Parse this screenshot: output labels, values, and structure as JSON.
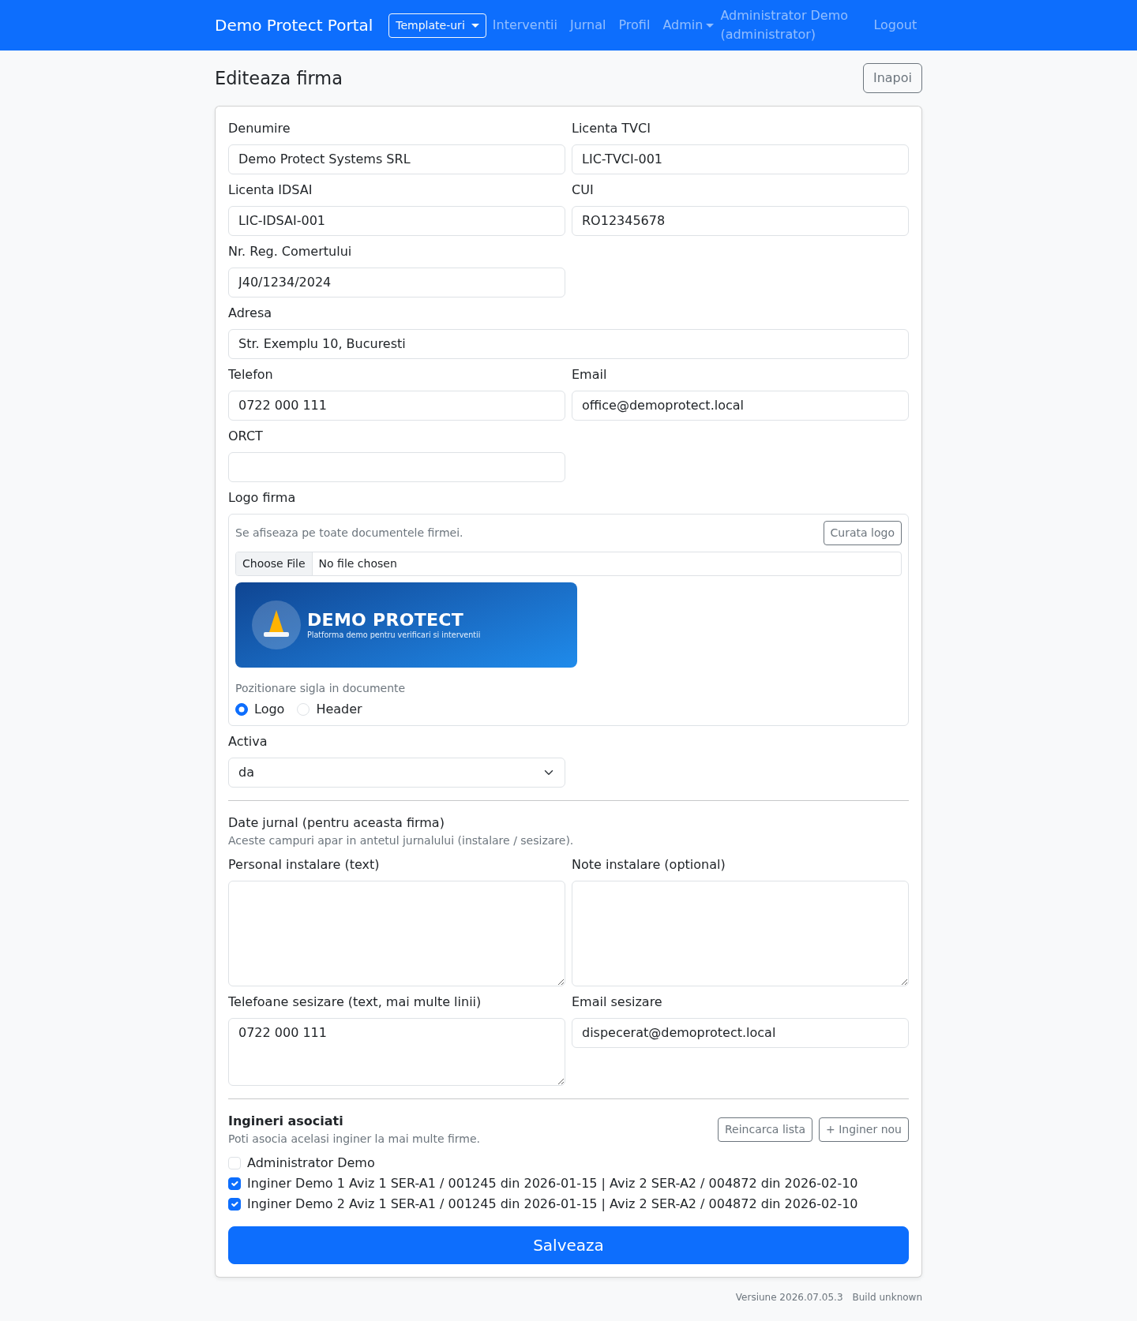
{
  "navbar": {
    "brand": "Demo Protect Portal",
    "items": [
      {
        "kind": "dropdown-button",
        "label": "Template-uri"
      },
      {
        "kind": "link",
        "label": "Interventii"
      },
      {
        "kind": "link",
        "label": "Jurnal"
      },
      {
        "kind": "link",
        "label": "Profil"
      },
      {
        "kind": "dropdown",
        "label": "Admin"
      },
      {
        "kind": "text",
        "label": "Administrator Demo (administrator)"
      },
      {
        "kind": "link",
        "label": "Logout"
      }
    ]
  },
  "page": {
    "title": "Editeaza firma",
    "back_button": "Inapoi"
  },
  "company_fields": [
    {
      "kind": "input",
      "label": "Denumire",
      "value": "Demo Protect Systems SRL"
    },
    {
      "kind": "input",
      "label": "Licenta TVCI",
      "value": "LIC-TVCI-001"
    },
    {
      "kind": "input",
      "label": "Licenta IDSAI",
      "value": "LIC-IDSAI-001"
    },
    {
      "kind": "input",
      "label": "CUI",
      "value": "RO12345678"
    },
    {
      "kind": "input",
      "label": "Nr. Reg. Comertului",
      "value": "J40/1234/2024"
    },
    {
      "kind": "wide-input",
      "label": "Adresa",
      "value": "Str. Exemplu 10, Bucuresti"
    },
    {
      "kind": "input",
      "label": "Telefon",
      "value": "0722 000 111"
    },
    {
      "kind": "input",
      "label": "Email",
      "value": "office@demoprotect.local"
    },
    {
      "kind": "input",
      "label": "ORCT"
    }
  ],
  "logo": {
    "label": "Logo firma",
    "hint": "Se afiseaza pe toate documentele firmei.",
    "clear_button": "Curata logo",
    "file_button": "Choose File",
    "file_status": "No file chosen",
    "preview": {
      "title": "DEMO PROTECT",
      "subtitle": "Platforma demo pentru verificari si interventii"
    },
    "position": {
      "label": "Pozitionare sigla in documente",
      "options": [
        {
          "label": "Logo",
          "selected": true
        },
        {
          "label": "Header",
          "selected": false
        }
      ]
    }
  },
  "status_field": {
    "label": "Activa",
    "value": "da"
  },
  "journal": {
    "title": "Date jurnal (pentru aceasta firma)",
    "note": "Aceste campuri apar in antetul jurnalului (instalare / sesizare).",
    "fields": [
      {
        "kind": "textarea",
        "label": "Personal instalare (text)"
      },
      {
        "kind": "textarea",
        "label": "Note instalare (optional)"
      },
      {
        "kind": "short-textarea",
        "label": "Telefoane sesizare (text, mai multe linii)",
        "value": "0722 000 111"
      },
      {
        "kind": "input",
        "label": "Email sesizare",
        "value": "dispecerat@demoprotect.local"
      }
    ]
  },
  "engineers": {
    "title": "Ingineri asociati",
    "note": "Poti asocia acelasi inginer la mai multe firme.",
    "buttons": [
      "Reincarca lista",
      "+ Inginer nou"
    ],
    "items": [
      {
        "label": "Administrator Demo",
        "checked": false
      },
      {
        "label": "Inginer Demo 1 Aviz 1 SER-A1 / 001245 din 2026-01-15 | Aviz 2 SER-A2 / 004872 din 2026-02-10",
        "checked": true
      },
      {
        "label": "Inginer Demo 2 Aviz 1 SER-A1 / 001245 din 2026-01-15 | Aviz 2 SER-A2 / 004872 din 2026-02-10",
        "checked": true
      }
    ]
  },
  "save_button": "Salveaza",
  "footer": {
    "version": "Versiune 2026.07.05.3",
    "build": "Build unknown"
  }
}
